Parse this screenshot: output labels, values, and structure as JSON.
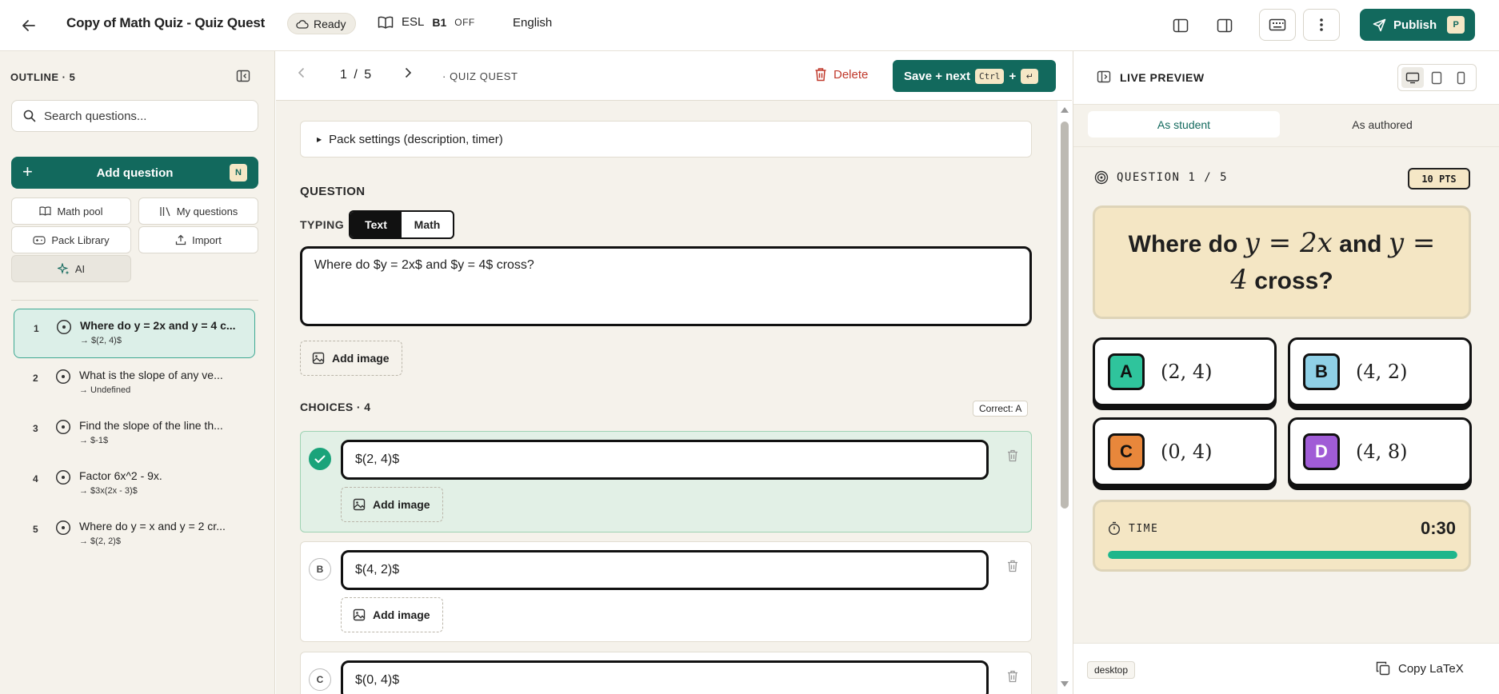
{
  "header": {
    "title": "Copy of Math Quiz - Quiz Quest",
    "status": "Ready",
    "esl": "ESL",
    "level": "B1",
    "esl_toggle": "OFF",
    "language": "English",
    "publish_label": "Publish",
    "avatar_initial": "P"
  },
  "sidebar": {
    "outline_title": "OUTLINE · 5",
    "search_placeholder": "Search questions...",
    "add_question_label": "Add question",
    "add_question_shortcut": "N",
    "buttons": {
      "math_pool": "Math pool",
      "my_questions": "My questions",
      "pack_library": "Pack Library",
      "import": "Import",
      "ai": "AI"
    },
    "items": [
      {
        "num": "1",
        "question": "Where do y = 2x and y = 4 c...",
        "answer": "→ $(2, 4)$"
      },
      {
        "num": "2",
        "question": "What is the slope of any ve...",
        "answer": "→ Undefined"
      },
      {
        "num": "3",
        "question": "Find the slope of the line th...",
        "answer": "→ $-1$"
      },
      {
        "num": "4",
        "question": "Factor 6x^2 - 9x.",
        "answer": "→ $3x(2x - 3)$"
      },
      {
        "num": "5",
        "question": "Where do y = x and y = 2 cr...",
        "answer": "→ $(2, 2)$"
      }
    ]
  },
  "editor": {
    "pager": "1 / 5",
    "breadcrumb": "· QUIZ QUEST",
    "delete_label": "Delete",
    "save_label": "Save + next",
    "save_kbd": "Ctrl",
    "save_plus": "+",
    "save_enter": "↵",
    "pack_settings": "Pack settings (description, timer)",
    "question_label": "QUESTION",
    "typing_label": "TYPING",
    "typing_options": [
      "Text",
      "Math"
    ],
    "question_text": "Where do $y = 2x$ and $y = 4$ cross?",
    "add_image": "Add image",
    "choices_label": "CHOICES · 4",
    "correct_label": "Correct: A",
    "choices": [
      {
        "letter": "A",
        "value": "$(2, 4)$",
        "correct": true
      },
      {
        "letter": "B",
        "value": "$(4, 2)$",
        "correct": false
      },
      {
        "letter": "C",
        "value": "$(0, 4)$",
        "correct": false
      }
    ]
  },
  "preview": {
    "title": "LIVE PREVIEW",
    "tabs": [
      "As student",
      "As authored"
    ],
    "question_counter": "QUESTION 1 / 5",
    "points": "10 PTS",
    "question_parts": {
      "pre": "Where do ",
      "eq1": "y = 2x",
      "mid": " and ",
      "eq2": "y = 4",
      "post": " cross?"
    },
    "answers": [
      {
        "letter": "A",
        "value": "(2, 4)",
        "color": "#2fc49c"
      },
      {
        "letter": "B",
        "value": "(4, 2)",
        "color": "#8fd0e6"
      },
      {
        "letter": "C",
        "value": "(0, 4)",
        "color": "#e8873b"
      },
      {
        "letter": "D",
        "value": "(4, 8)",
        "color": "#a05cd6"
      }
    ],
    "timer_label": "TIME",
    "timer_value": "0:30",
    "timer_fraction": 1.0,
    "device_label": "desktop",
    "copy_latex": "Copy LaTeX"
  },
  "colors": {
    "brand": "#12695d",
    "accent_cream": "#f5e7c6",
    "danger": "#c0392b",
    "timer_green": "#1fb68b"
  }
}
